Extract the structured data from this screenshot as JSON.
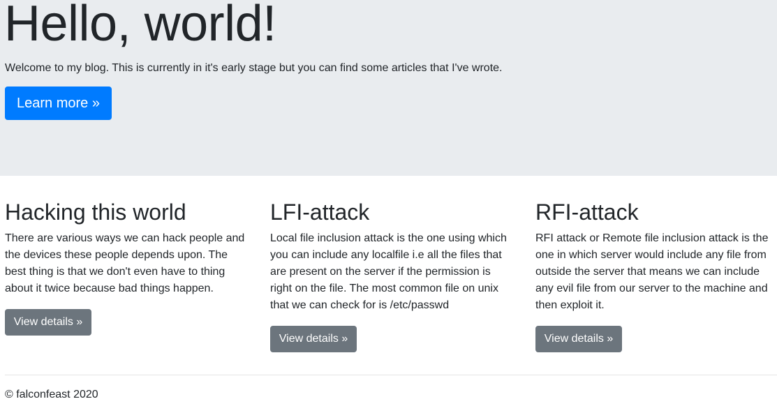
{
  "hero": {
    "title": "Hello, world!",
    "lead": "Welcome to my blog. This is currently in it's early stage but you can find some articles that I've wrote.",
    "button_label": "Learn more »"
  },
  "articles": [
    {
      "heading": "Hacking this world",
      "body": "There are various ways we can hack people and the devices these people depends upon. The best thing is that we don't even have to thing about it twice because bad things happen.",
      "button_label": "View details »"
    },
    {
      "heading": "LFI-attack",
      "body": "Local file inclusion attack is the one using which you can include any localfile i.e all the files that are present on the server if the permission is right on the file. The most common file on unix that we can check for is /etc/passwd",
      "button_label": "View details »"
    },
    {
      "heading": "RFI-attack",
      "body": "RFI attack or Remote file inclusion attack is the one in which server would include any file from outside the server that means we can include any evil file from our server to the machine and then exploit it.",
      "button_label": "View details »"
    }
  ],
  "footer": {
    "copyright": "© falconfeast 2020"
  },
  "colors": {
    "jumbotron_bg": "#e9ecef",
    "primary": "#007bff",
    "secondary": "#6c757d",
    "text": "#212529"
  }
}
